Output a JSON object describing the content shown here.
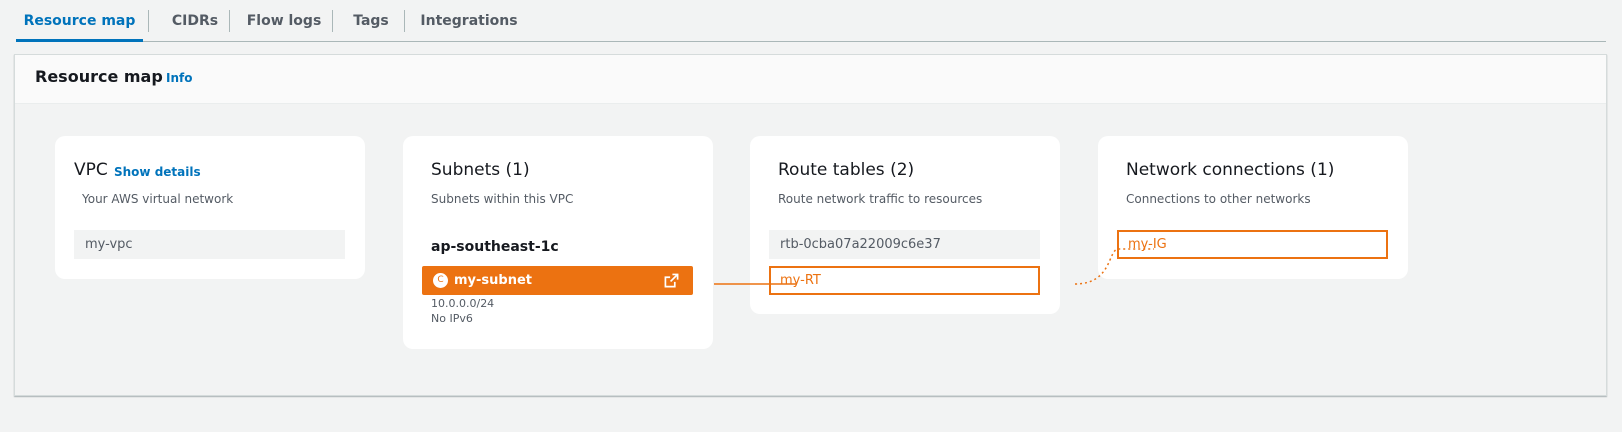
{
  "tabs": [
    {
      "label": "Resource map",
      "active": true
    },
    {
      "label": "CIDRs"
    },
    {
      "label": "Flow logs"
    },
    {
      "label": "Tags"
    },
    {
      "label": "Integrations"
    }
  ],
  "panel": {
    "title": "Resource map",
    "info": "Info"
  },
  "vpc": {
    "title": "VPC",
    "show_details": "Show details",
    "subtitle": "Your AWS virtual network",
    "name": "my-vpc"
  },
  "subnets": {
    "title": "Subnets (1)",
    "subtitle": "Subnets within this VPC",
    "az": "ap-southeast-1c",
    "subnet": {
      "badge": "C",
      "name": "my-subnet",
      "cidr": "10.0.0.0/24",
      "ipv6": "No IPv6"
    }
  },
  "route_tables": {
    "title": "Route tables (2)",
    "subtitle": "Route network traffic to resources",
    "items": [
      "rtb-0cba07a22009c6e37",
      "my-RT"
    ]
  },
  "network_connections": {
    "title": "Network connections (1)",
    "subtitle": "Connections to other networks",
    "items": [
      "my-IG"
    ]
  },
  "colors": {
    "accent": "#0073bb",
    "highlight": "#ec7211",
    "background": "#f2f3f3"
  }
}
